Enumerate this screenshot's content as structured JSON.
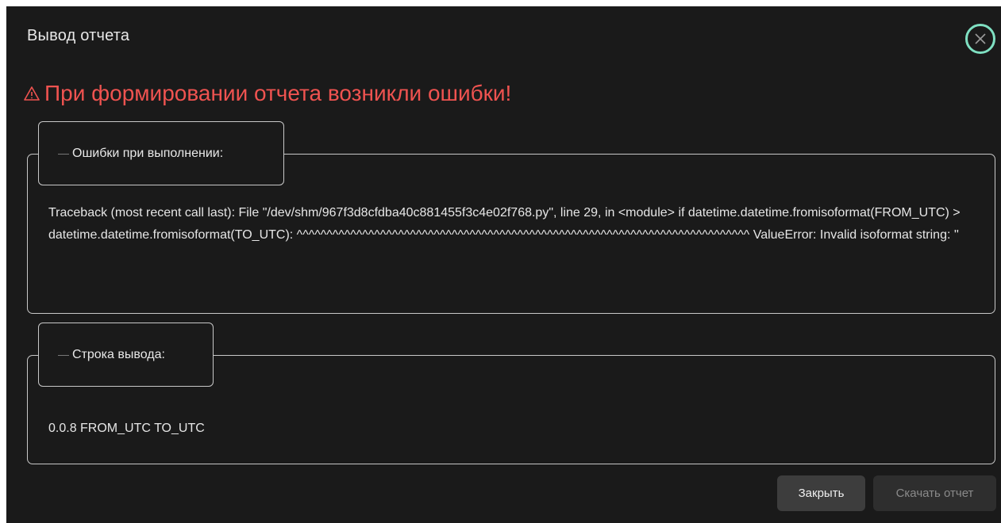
{
  "dialog": {
    "title": "Вывод отчета",
    "close_icon": "close-x-icon",
    "accent_color": "#7fe0c2"
  },
  "error": {
    "icon": "warning-triangle-icon",
    "heading": "При формировании отчета возникли ошибки!",
    "color": "#ef5350"
  },
  "errors_section": {
    "legend": "Ошибки при выполнении:",
    "text": "Traceback (most recent call last): File \"/dev/shm/967f3d8cfdba40c881455f3c4e02f768.py\", line 29, in <module> if datetime.datetime.fromisoformat(FROM_UTC) > datetime.datetime.fromisoformat(TO_UTC): ^^^^^^^^^^^^^^^^^^^^^^^^^^^^^^^^^^^^^^^^^^^^^^^^^^^^^^^^^^^^^^^^^^^^^^^^^^^^ ValueError: Invalid isoformat string: ''"
  },
  "output_section": {
    "legend": "Строка вывода:",
    "text": "0.0.8 FROM_UTC TO_UTC"
  },
  "footer": {
    "close_label": "Закрыть",
    "download_label": "Скачать отчет"
  }
}
